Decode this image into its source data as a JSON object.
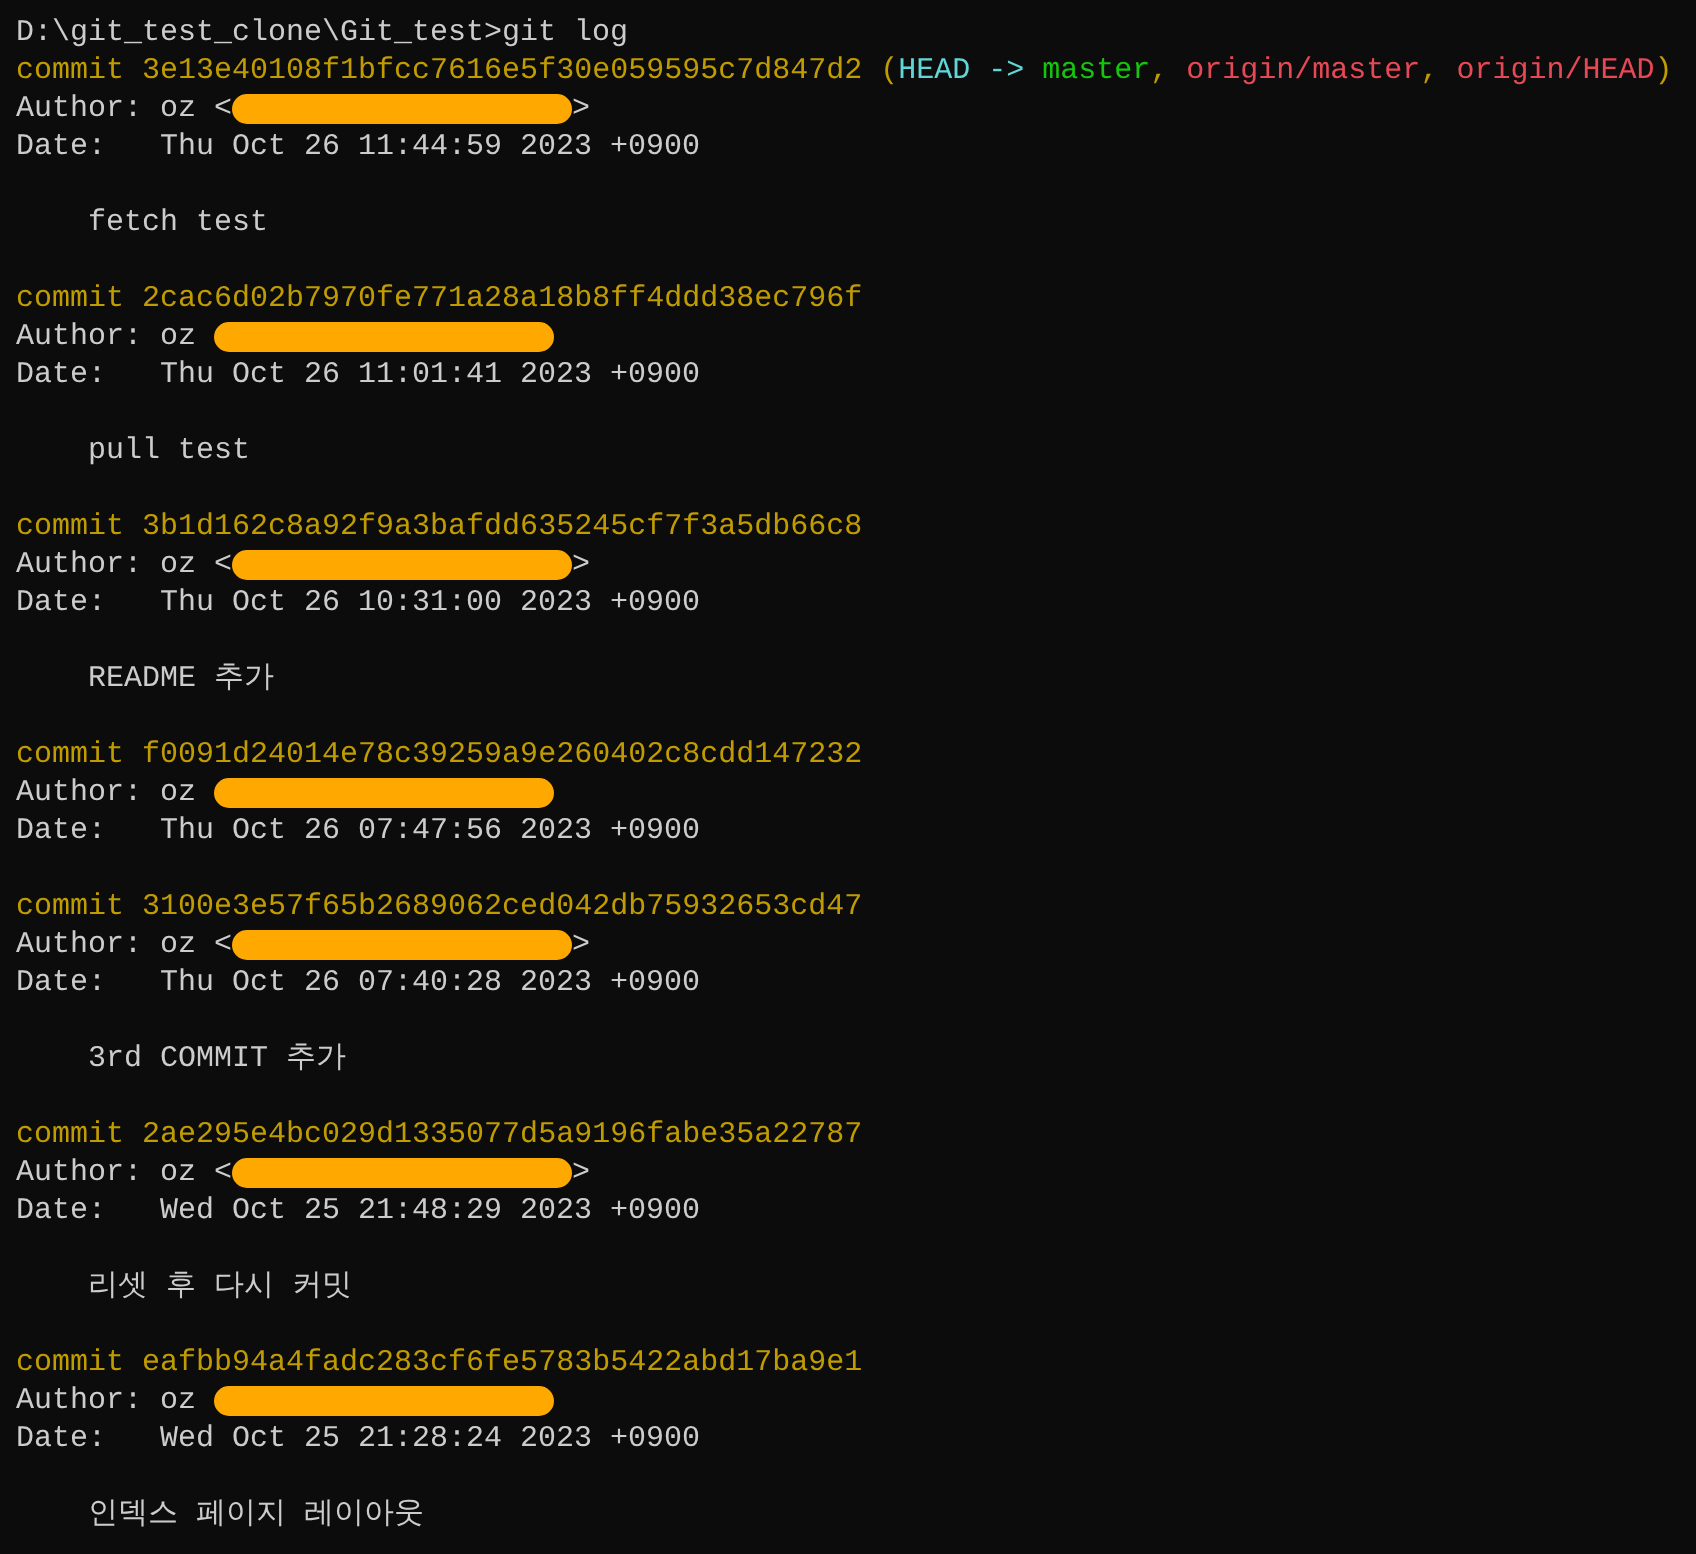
{
  "terminal": {
    "prompt_line": "D:\\git_test_clone\\Git_test>git log",
    "commits": [
      {
        "label": "commit",
        "hash": "3e13e40108f1bfcc7616e5f30e059595c7d847d2",
        "refs": [
          {
            "text": " (",
            "kind": "punct"
          },
          {
            "text": "HEAD ->",
            "kind": "head"
          },
          {
            "text": " master",
            "kind": "branch"
          },
          {
            "text": ", ",
            "kind": "punct"
          },
          {
            "text": "origin/master",
            "kind": "remote"
          },
          {
            "text": ", ",
            "kind": "punct"
          },
          {
            "text": "origin/HEAD",
            "kind": "remote"
          },
          {
            "text": ")",
            "kind": "punct"
          }
        ],
        "author_prefix": "Author: oz <",
        "author_suffix": ">",
        "date": "Date:   Thu Oct 26 11:44:59 2023 +0900",
        "message": "fetch test"
      },
      {
        "label": "commit",
        "hash": "2cac6d02b7970fe771a28a18b8ff4ddd38ec796f",
        "author_prefix": "Author: oz",
        "date": "Date:   Thu Oct 26 11:01:41 2023 +0900",
        "message": "pull test"
      },
      {
        "label": "commit",
        "hash": "3b1d162c8a92f9a3bafdd635245cf7f3a5db66c8",
        "author_prefix": "Author: oz <",
        "author_suffix": ">",
        "date": "Date:   Thu Oct 26 10:31:00 2023 +0900",
        "message": "README 추가"
      },
      {
        "label": "commit",
        "hash": "f0091d24014e78c39259a9e260402c8cdd147232",
        "author_prefix": "Author: oz",
        "date": "Date:   Thu Oct 26 07:47:56 2023 +0900"
      },
      {
        "label": "commit",
        "hash": "3100e3e57f65b2689062ced042db75932653cd47",
        "author_prefix": "Author: oz <",
        "author_suffix": ">",
        "date": "Date:   Thu Oct 26 07:40:28 2023 +0900",
        "message": "3rd COMMIT 추가"
      },
      {
        "label": "commit",
        "hash": "2ae295e4bc029d1335077d5a9196fabe35a22787",
        "author_prefix": "Author: oz <",
        "author_suffix": ">",
        "date": "Date:   Wed Oct 25 21:48:29 2023 +0900",
        "message": "리셋 후 다시 커밋"
      },
      {
        "label": "commit",
        "hash": "eafbb94a4fadc283cf6fe5783b5422abd17ba9e1",
        "author_prefix": "Author: oz",
        "date": "Date:   Wed Oct 25 21:28:24 2023 +0900",
        "message": "인덱스 페이지 레이아웃"
      }
    ]
  }
}
